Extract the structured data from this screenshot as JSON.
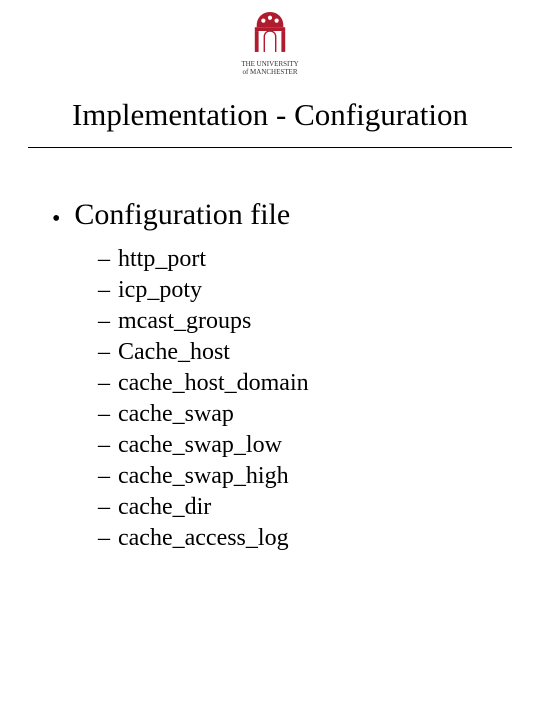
{
  "header": {
    "institution_line1": "THE UNIVERSITY",
    "institution_line2": "of MANCHESTER"
  },
  "title": "Implementation - Configuration",
  "main_bullet": "Configuration file",
  "sub_items": [
    "http_port",
    "icp_poty",
    "mcast_groups",
    "Cache_host",
    "cache_host_domain",
    "cache_swap",
    "cache_swap_low",
    "cache_swap_high",
    "cache_dir",
    "cache_access_log"
  ]
}
